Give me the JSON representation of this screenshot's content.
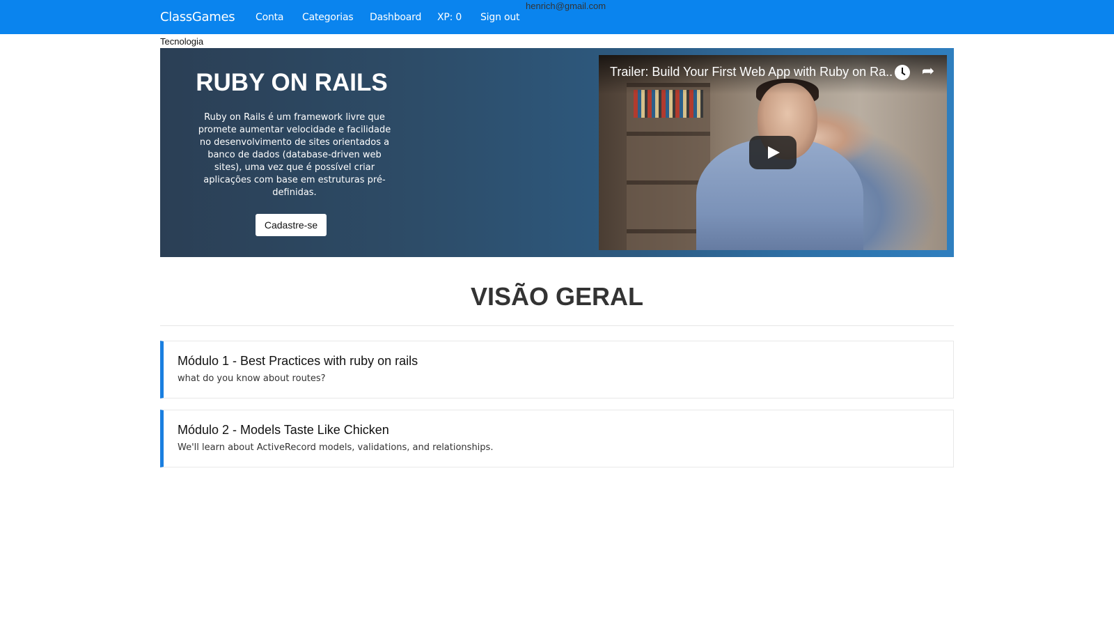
{
  "navbar": {
    "brand": "ClassGames",
    "links": [
      "Conta",
      "Categorias",
      "Dashboard",
      "XP: 0",
      "Sign out"
    ],
    "email": "henrich@gmail.com"
  },
  "breadcrumb": "Tecnologia",
  "hero": {
    "title": "RUBY ON RAILS",
    "description": "Ruby on Rails é um framework livre que promete aumentar velocidade e facilidade no desenvolvimento de sites orientados a banco de dados (database-driven web sites), uma vez que é possível criar aplicações com base em estruturas pré-definidas.",
    "button_label": "Cadastre-se"
  },
  "video": {
    "title": "Trailer: Build Your First Web App with Ruby on Ra...",
    "icons": [
      "clock-icon",
      "share-icon",
      "play-icon"
    ],
    "share_glyph": "➦"
  },
  "overview": {
    "title": "VISÃO GERAL",
    "modules": [
      {
        "title": "Módulo 1 - Best Practices with ruby on rails",
        "description": "what do you know about routes?"
      },
      {
        "title": "Módulo 2 - Models Taste Like Chicken",
        "description": "We'll learn about ActiveRecord models, validations, and relationships."
      }
    ]
  },
  "colors": {
    "navbar": "#0a84ee",
    "module_accent": "#1a7fe0",
    "hero_dark": "#2b3f55",
    "hero_light": "#2f7fbf"
  }
}
